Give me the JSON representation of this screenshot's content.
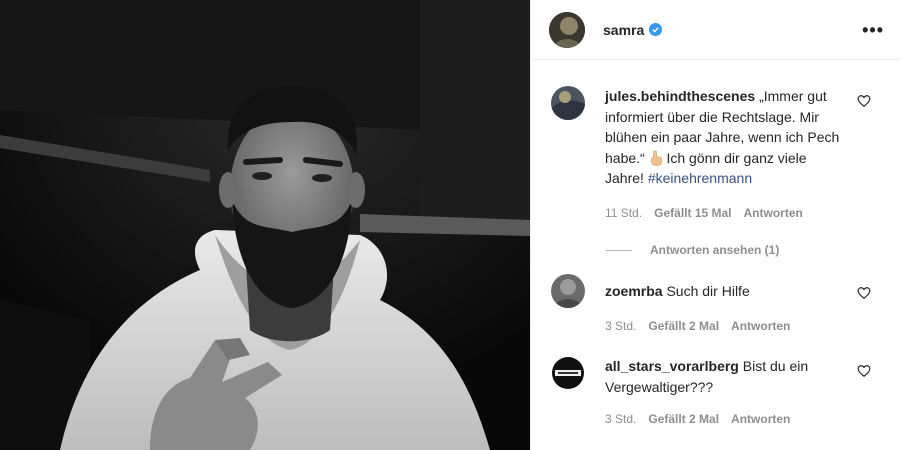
{
  "post": {
    "username": "samra",
    "verified": true,
    "more_icon": "more-options-icon"
  },
  "comments": [
    {
      "username": "jules.behindthescenes",
      "text_before_emoji": "„Immer gut informiert über die Rechtslage. Mir blühen ein paar Jahre, wenn ich Pech habe.“",
      "emoji": "middle-finger-emoji",
      "text_after_emoji": " Ich gönn dir ganz viele Jahre!",
      "hashtag": "#keinehrenmann",
      "time": "11 Std.",
      "likes": "Gefällt 15 Mal",
      "reply_label": "Antworten",
      "view_replies": "Antworten ansehen (1)"
    },
    {
      "username": "zoemrba",
      "text": "Such dir Hilfe",
      "time": "3 Std.",
      "likes": "Gefällt 2 Mal",
      "reply_label": "Antworten"
    },
    {
      "username": "all_stars_vorarlberg",
      "text": "Bist du ein Vergewaltiger???",
      "time": "3 Std.",
      "likes": "Gefällt 2 Mal",
      "reply_label": "Antworten"
    }
  ]
}
